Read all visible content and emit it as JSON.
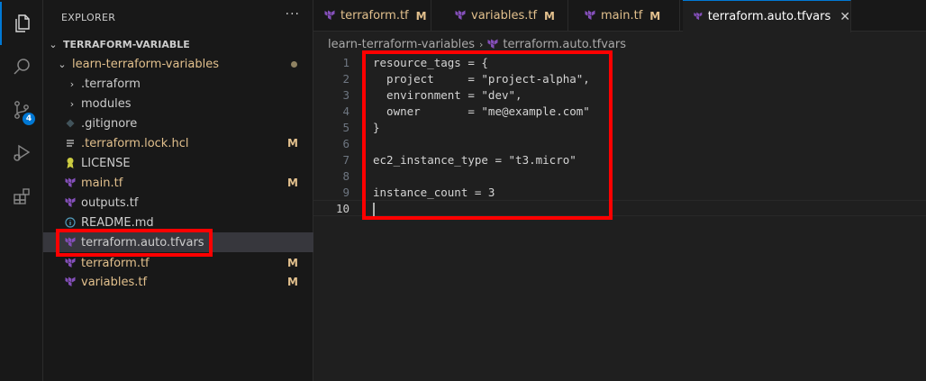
{
  "activity_bar": {
    "items": [
      {
        "icon": "files-icon"
      },
      {
        "icon": "search-icon"
      },
      {
        "icon": "source-control-icon",
        "badge": "4"
      },
      {
        "icon": "run-debug-icon"
      },
      {
        "icon": "extensions-icon"
      }
    ]
  },
  "sidebar": {
    "header": "EXPLORER",
    "more": "···",
    "root_folder": "TERRAFORM-VARIABLE",
    "project_folder": "learn-terraform-variables",
    "items": [
      {
        "label": ".terraform",
        "type": "folder",
        "mod": ""
      },
      {
        "label": "modules",
        "type": "folder",
        "mod": ""
      },
      {
        "label": ".gitignore",
        "type": "gitignore",
        "mod": ""
      },
      {
        "label": ".terraform.lock.hcl",
        "type": "lock",
        "mod": "M"
      },
      {
        "label": "LICENSE",
        "type": "license",
        "mod": ""
      },
      {
        "label": "main.tf",
        "type": "terraform",
        "mod": "M"
      },
      {
        "label": "outputs.tf",
        "type": "terraform",
        "mod": ""
      },
      {
        "label": "README.md",
        "type": "readme",
        "mod": ""
      },
      {
        "label": "terraform.auto.tfvars",
        "type": "terraform",
        "mod": ""
      },
      {
        "label": "terraform.tf",
        "type": "terraform",
        "mod": "M"
      },
      {
        "label": "variables.tf",
        "type": "terraform",
        "mod": "M"
      }
    ]
  },
  "tabs": [
    {
      "label": "terraform.tf",
      "mod": "M"
    },
    {
      "label": "variables.tf",
      "mod": "M"
    },
    {
      "label": "main.tf",
      "mod": "M"
    },
    {
      "label": "terraform.auto.tfvars",
      "close": "✕"
    }
  ],
  "breadcrumb": {
    "folder": "learn-terraform-variables",
    "file": "terraform.auto.tfvars"
  },
  "editor": {
    "lines": [
      {
        "num": "1",
        "text": "resource_tags = {"
      },
      {
        "num": "2",
        "text": "  project     = \"project-alpha\","
      },
      {
        "num": "3",
        "text": "  environment = \"dev\","
      },
      {
        "num": "4",
        "text": "  owner       = \"me@example.com\""
      },
      {
        "num": "5",
        "text": "}"
      },
      {
        "num": "6",
        "text": ""
      },
      {
        "num": "7",
        "text": "ec2_instance_type = \"t3.micro\""
      },
      {
        "num": "8",
        "text": ""
      },
      {
        "num": "9",
        "text": "instance_count = 3"
      },
      {
        "num": "10",
        "text": ""
      }
    ]
  },
  "colors": {
    "accent": "#0078d4",
    "highlight": "#ff0000",
    "terraform": "#844fba",
    "modified": "#e2c08d"
  }
}
